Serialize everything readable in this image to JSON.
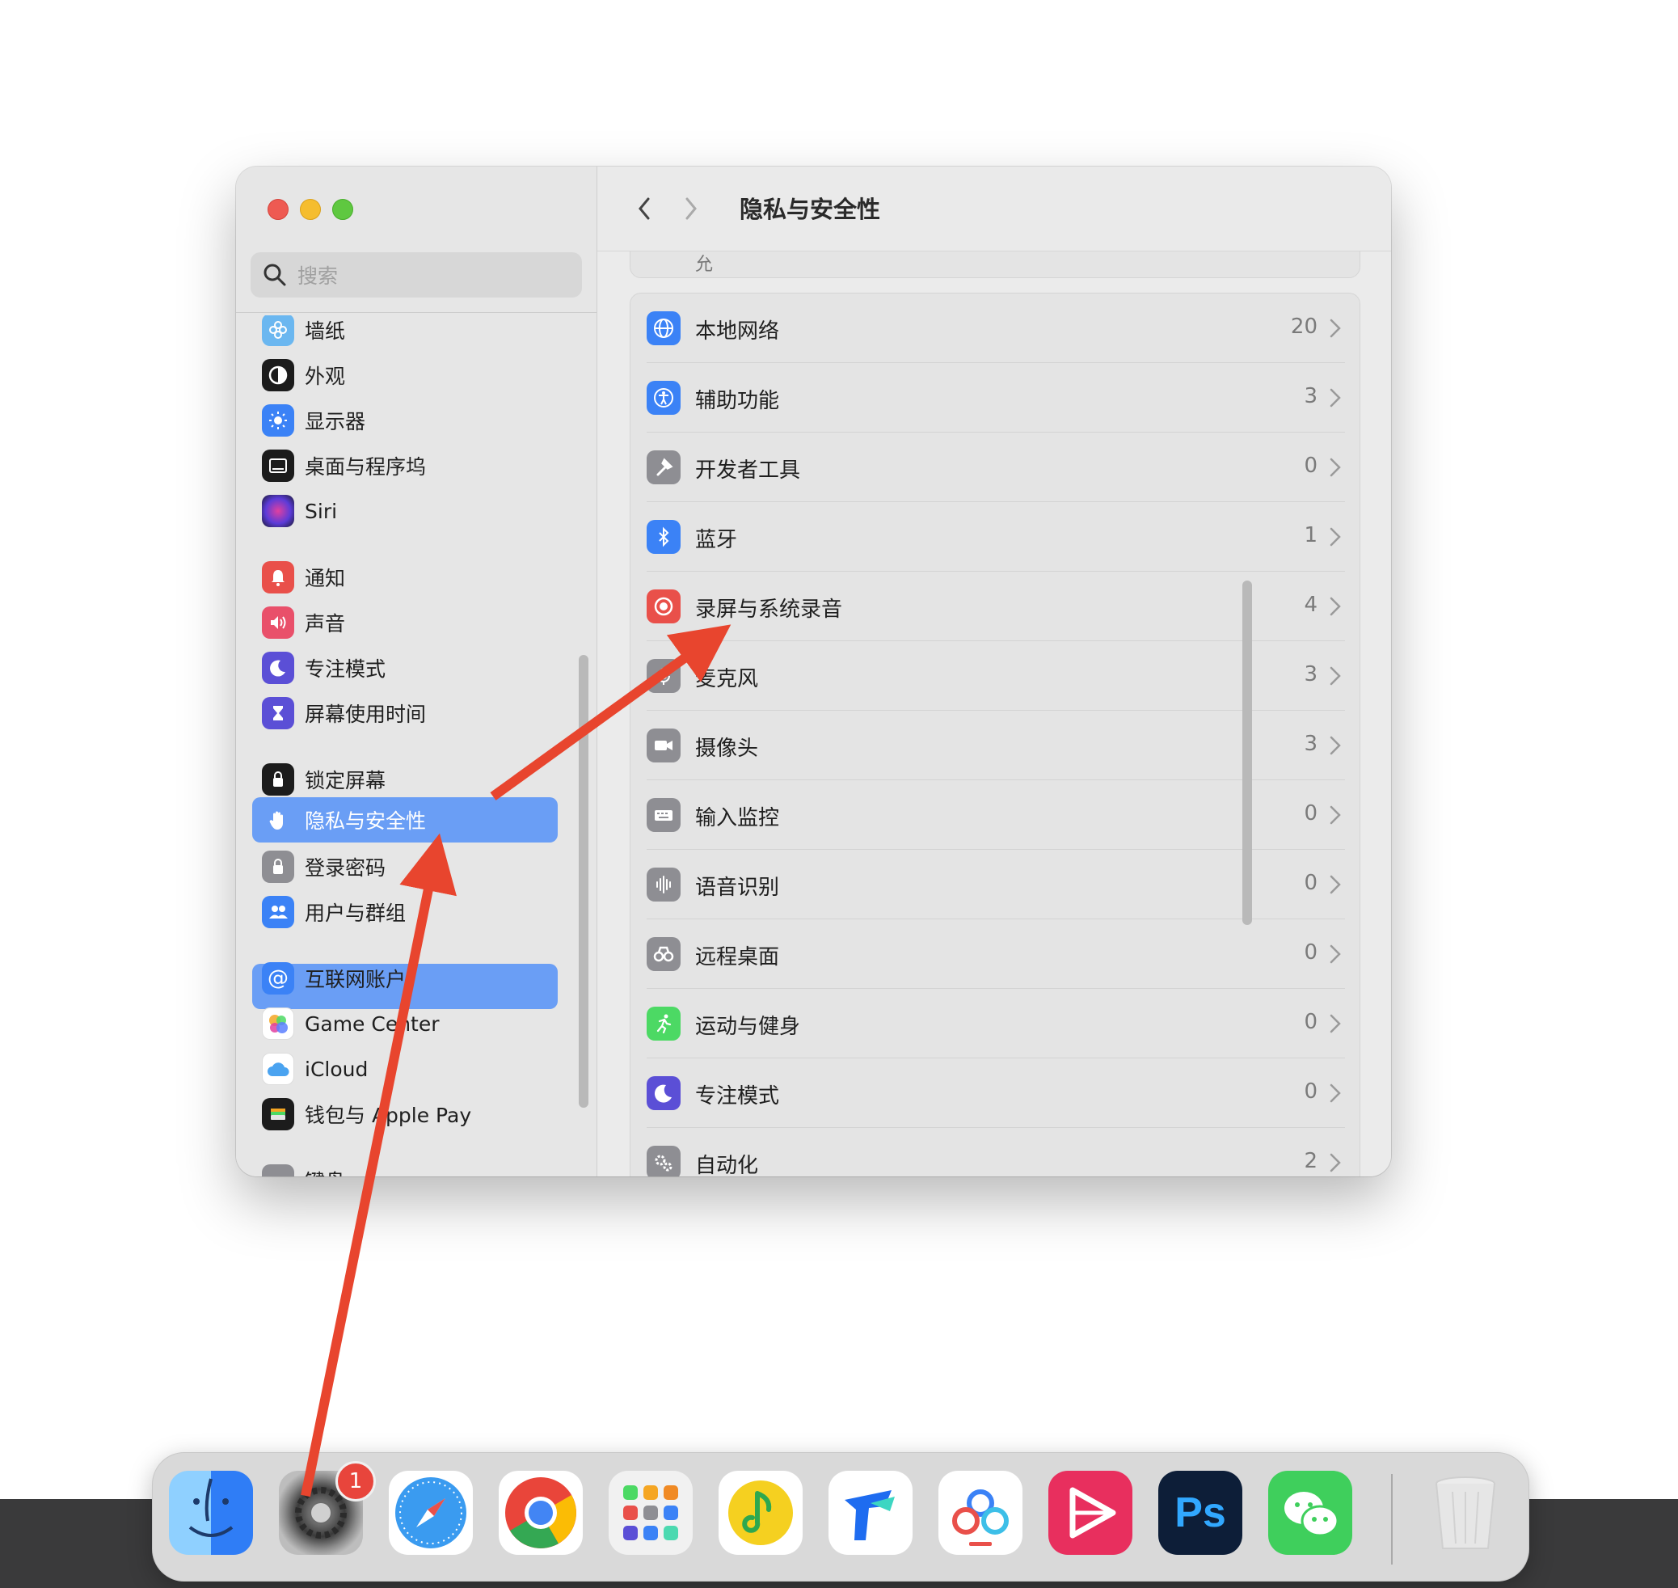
{
  "sidebar": {
    "search_placeholder": "搜索",
    "items": [
      {
        "label": "墙纸",
        "icon": "wallpaper-icon"
      },
      {
        "label": "外观",
        "icon": "appearance-icon"
      },
      {
        "label": "显示器",
        "icon": "display-icon"
      },
      {
        "label": "桌面与程序坞",
        "icon": "desktop-dock-icon"
      },
      {
        "label": "Siri",
        "icon": "siri-icon"
      },
      {
        "label": "通知",
        "icon": "notifications-icon"
      },
      {
        "label": "声音",
        "icon": "sound-icon"
      },
      {
        "label": "专注模式",
        "icon": "focus-icon"
      },
      {
        "label": "屏幕使用时间",
        "icon": "screen-time-icon"
      },
      {
        "label": "锁定屏幕",
        "icon": "lock-screen-icon"
      },
      {
        "label": "隐私与安全性",
        "icon": "privacy-hand-icon",
        "selected": true
      },
      {
        "label": "登录密码",
        "icon": "login-password-icon"
      },
      {
        "label": "用户与群组",
        "icon": "users-groups-icon"
      },
      {
        "label": "互联网账户",
        "icon": "internet-accounts-icon"
      },
      {
        "label": "Game Center",
        "icon": "game-center-icon"
      },
      {
        "label": "iCloud",
        "icon": "icloud-icon"
      },
      {
        "label": "钱包与 Apple Pay",
        "icon": "wallet-icon"
      },
      {
        "label": "键盘",
        "icon": "keyboard-icon"
      }
    ]
  },
  "main": {
    "title": "隐私与安全性",
    "top_partial_text": "允",
    "rows": [
      {
        "label": "本地网络",
        "count": "20",
        "icon": "local-network-icon"
      },
      {
        "label": "辅助功能",
        "count": "3",
        "icon": "accessibility-icon"
      },
      {
        "label": "开发者工具",
        "count": "0",
        "icon": "developer-tools-icon"
      },
      {
        "label": "蓝牙",
        "count": "1",
        "icon": "bluetooth-icon"
      },
      {
        "label": "录屏与系统录音",
        "count": "4",
        "icon": "screen-recording-icon"
      },
      {
        "label": "麦克风",
        "count": "3",
        "icon": "microphone-icon"
      },
      {
        "label": "摄像头",
        "count": "3",
        "icon": "camera-icon"
      },
      {
        "label": "输入监控",
        "count": "0",
        "icon": "input-monitoring-icon"
      },
      {
        "label": "语音识别",
        "count": "0",
        "icon": "speech-recognition-icon"
      },
      {
        "label": "远程桌面",
        "count": "0",
        "icon": "remote-desktop-icon"
      },
      {
        "label": "运动与健身",
        "count": "0",
        "icon": "motion-fitness-icon"
      },
      {
        "label": "专注模式",
        "count": "0",
        "icon": "focus-icon"
      },
      {
        "label": "自动化",
        "count": "2",
        "icon": "automation-icon"
      }
    ]
  },
  "dock": {
    "settings_badge": "1",
    "apps": [
      "finder-icon",
      "system-settings-icon",
      "safari-icon",
      "chrome-icon",
      "launchpad-icon",
      "qq-music-icon",
      "lark-icon",
      "baidu-netdisk-icon",
      "kuaiying-icon",
      "photoshop-icon",
      "wechat-icon",
      "trash-icon"
    ],
    "ps_label": "Ps"
  },
  "colors": {
    "selected": "#6a9ef5",
    "arrow": "#e8452e"
  }
}
